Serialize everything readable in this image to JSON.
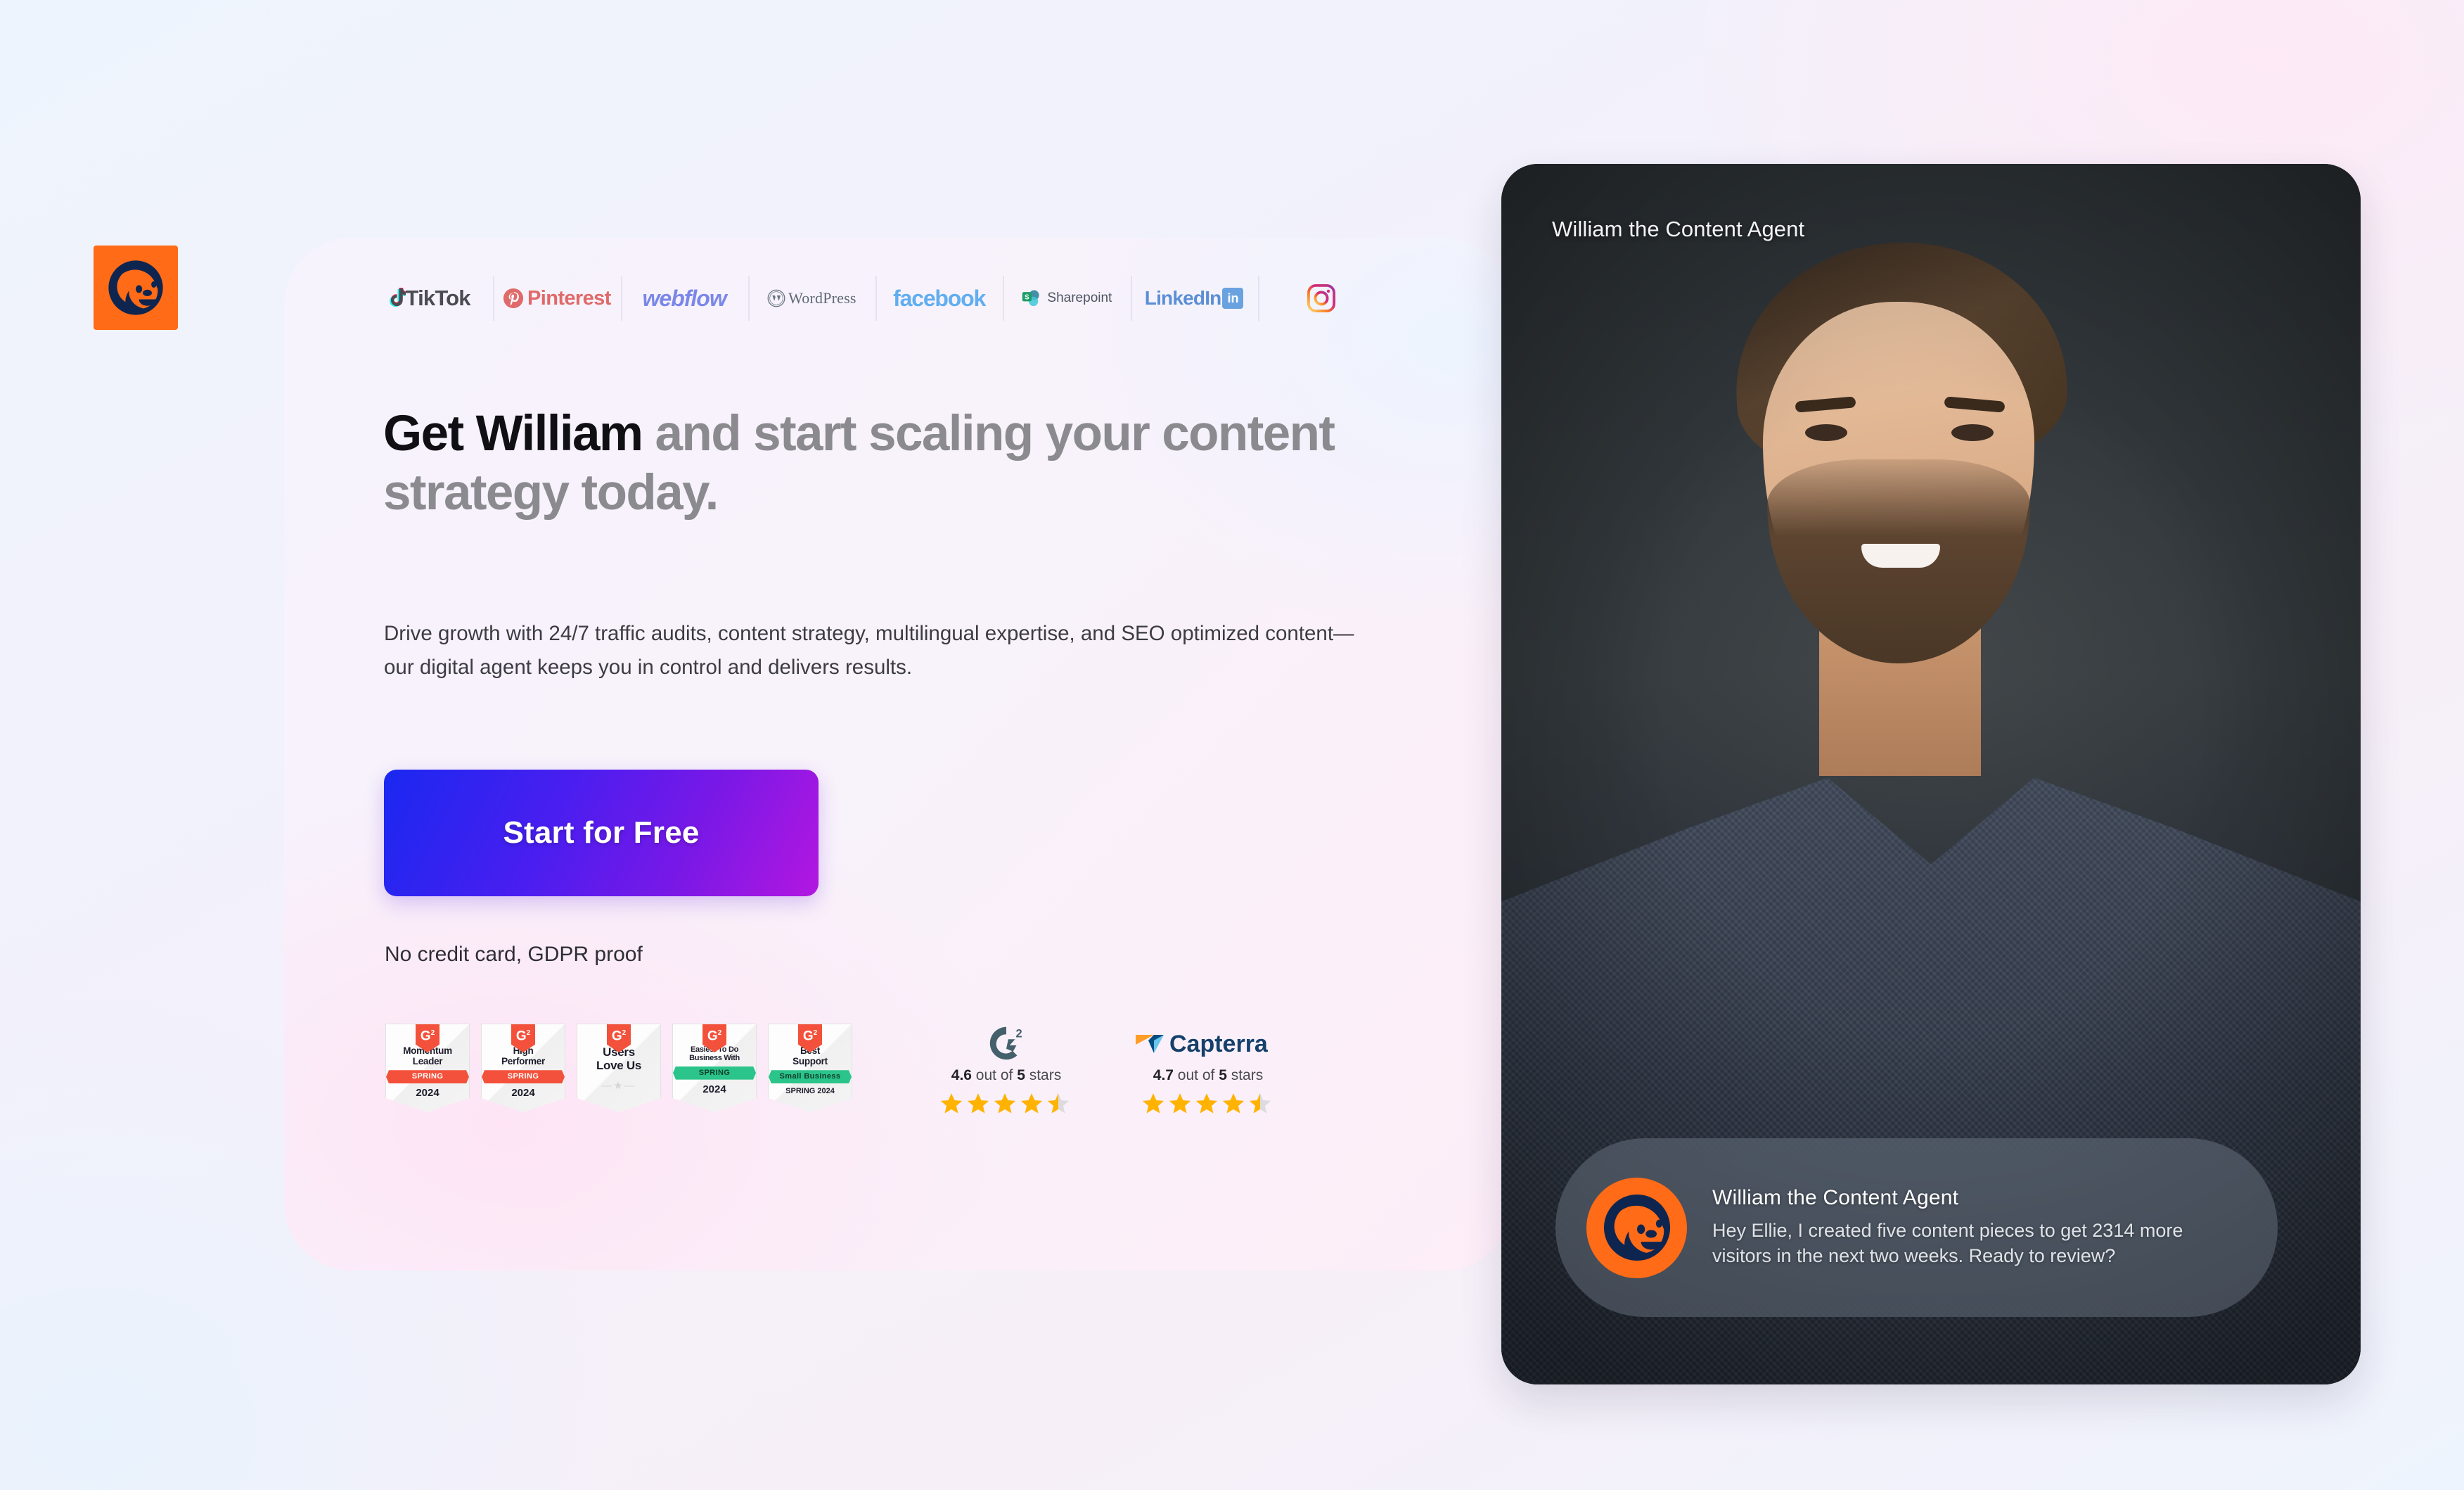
{
  "brand": {
    "logo_icon": "sloth-mascot-icon",
    "bg_color": "#FF6B16",
    "mark_color": "#0E2550"
  },
  "partner_logos": [
    {
      "name": "TikTok",
      "icon": "tiktok-logo"
    },
    {
      "name": "Pinterest",
      "icon": "pinterest-logo"
    },
    {
      "name": "webflow",
      "icon": "webflow-logo"
    },
    {
      "name": "WordPress",
      "icon": "wordpress-logo"
    },
    {
      "name": "facebook",
      "icon": "facebook-logo"
    },
    {
      "name": "Sharepoint",
      "icon": "sharepoint-logo"
    },
    {
      "name": "LinkedIn",
      "icon": "linkedin-logo"
    },
    {
      "name": "Instagram",
      "icon": "instagram-logo"
    }
  ],
  "hero": {
    "headline_strong": "Get William",
    "headline_rest": " and start scaling your content strategy today.",
    "subheadline": "Drive growth with 24/7 traffic audits, content strategy, multilingual expertise, and SEO optimized content—our digital agent keeps you in control and delivers results.",
    "cta_label": "Start for Free",
    "cta_gradient_from": "#1A28F0",
    "cta_gradient_to": "#B317E0",
    "disclaimer": "No credit card, GDPR proof"
  },
  "badges": [
    {
      "title_line1": "Momentum",
      "title_line2": "Leader",
      "ribbon": "SPRING",
      "ribbon_color": "#F3513B",
      "year": "2024",
      "mark": "G2"
    },
    {
      "title_line1": "High",
      "title_line2": "Performer",
      "ribbon": "SPRING",
      "ribbon_color": "#F3513B",
      "year": "2024",
      "mark": "G2"
    },
    {
      "title_line1": "Users",
      "title_line2": "Love Us",
      "ribbon": "",
      "ribbon_color": "",
      "year": "",
      "mark": "G2"
    },
    {
      "title_line1": "Easiest To Do",
      "title_line2": "Business With",
      "ribbon": "SPRING",
      "ribbon_color": "#2BC48A",
      "year": "2024",
      "mark": "G2"
    },
    {
      "title_line1": "Best",
      "title_line2": "Support",
      "ribbon": "Small Business",
      "ribbon_color": "#2BC48A",
      "year": "SPRING 2024",
      "mark": "G2"
    }
  ],
  "ratings": [
    {
      "source": "G2",
      "logo_icon": "g2-logo",
      "score": "4.6",
      "text_mid": " out of ",
      "max": "5",
      "text_end": " stars",
      "stars": 4.5,
      "star_color": "#FFB300"
    },
    {
      "source": "Capterra",
      "logo_icon": "capterra-logo",
      "score": "4.7",
      "text_mid": " out of ",
      "max": "5",
      "text_end": " stars",
      "stars": 4.5,
      "star_color": "#FFB300"
    }
  ],
  "agent_panel": {
    "caption": "William the Content Agent",
    "chat_name": "William the Content Agent",
    "chat_message": "Hey Ellie, I created five content pieces to get 2314 more visitors in the next two weeks. Ready to review?",
    "avatar_icon": "sloth-mascot-icon"
  }
}
